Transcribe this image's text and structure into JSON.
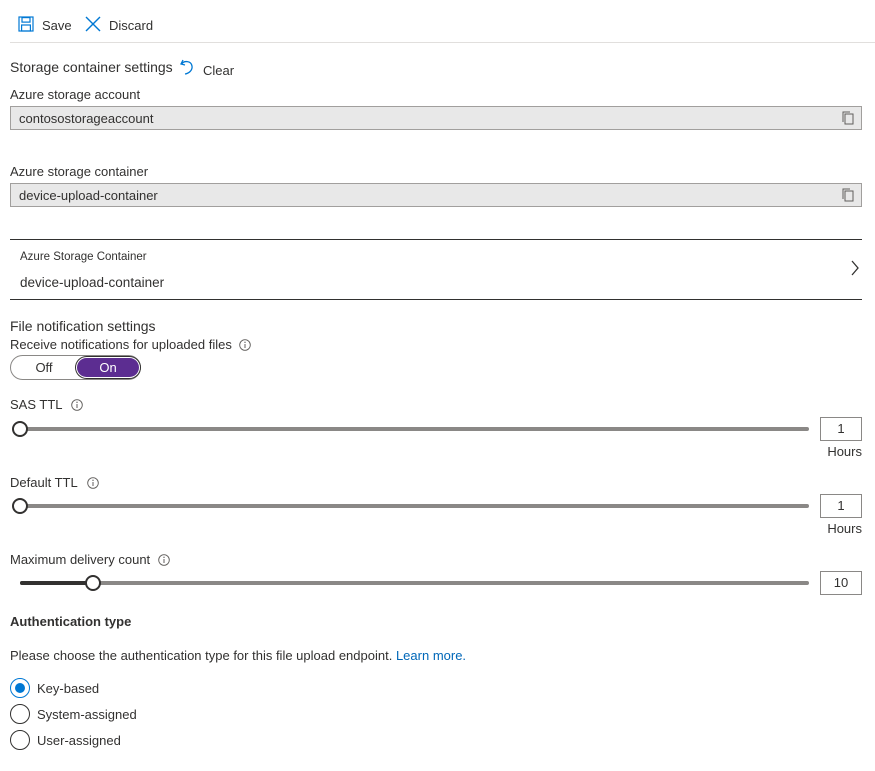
{
  "toolbar": {
    "save_label": "Save",
    "discard_label": "Discard"
  },
  "storage": {
    "section_title": "Storage container settings",
    "clear_label": "Clear",
    "account_label": "Azure storage account",
    "account_value": "contosostorageaccount",
    "container_label": "Azure storage container",
    "container_value": "device-upload-container"
  },
  "picker": {
    "caption": "Azure Storage Container",
    "value": "device-upload-container"
  },
  "notifications": {
    "section_title": "File notification settings",
    "receive_label": "Receive notifications for uploaded files",
    "toggle_off": "Off",
    "toggle_on": "On",
    "toggle_state": "On"
  },
  "sliders": {
    "sas_ttl": {
      "label": "SAS TTL",
      "value": "1",
      "unit": "Hours",
      "fraction": 0
    },
    "default_ttl": {
      "label": "Default TTL",
      "value": "1",
      "unit": "Hours",
      "fraction": 0
    },
    "max_delivery": {
      "label": "Maximum delivery count",
      "value": "10",
      "fraction": 0.092
    }
  },
  "auth": {
    "title": "Authentication type",
    "description": "Please choose the authentication type for this file upload endpoint.",
    "learn_more": "Learn more.",
    "options": [
      "Key-based",
      "System-assigned",
      "User-assigned"
    ],
    "selected": "Key-based"
  },
  "colors": {
    "accent": "#0078d4",
    "toggle_on": "#5c2d91",
    "link": "#0067b8"
  },
  "icons": {
    "save": "save-icon",
    "discard": "close-icon",
    "clear": "undo-icon",
    "copy": "copy-icon",
    "info": "info-icon",
    "chevron": "chevron-right-icon"
  }
}
